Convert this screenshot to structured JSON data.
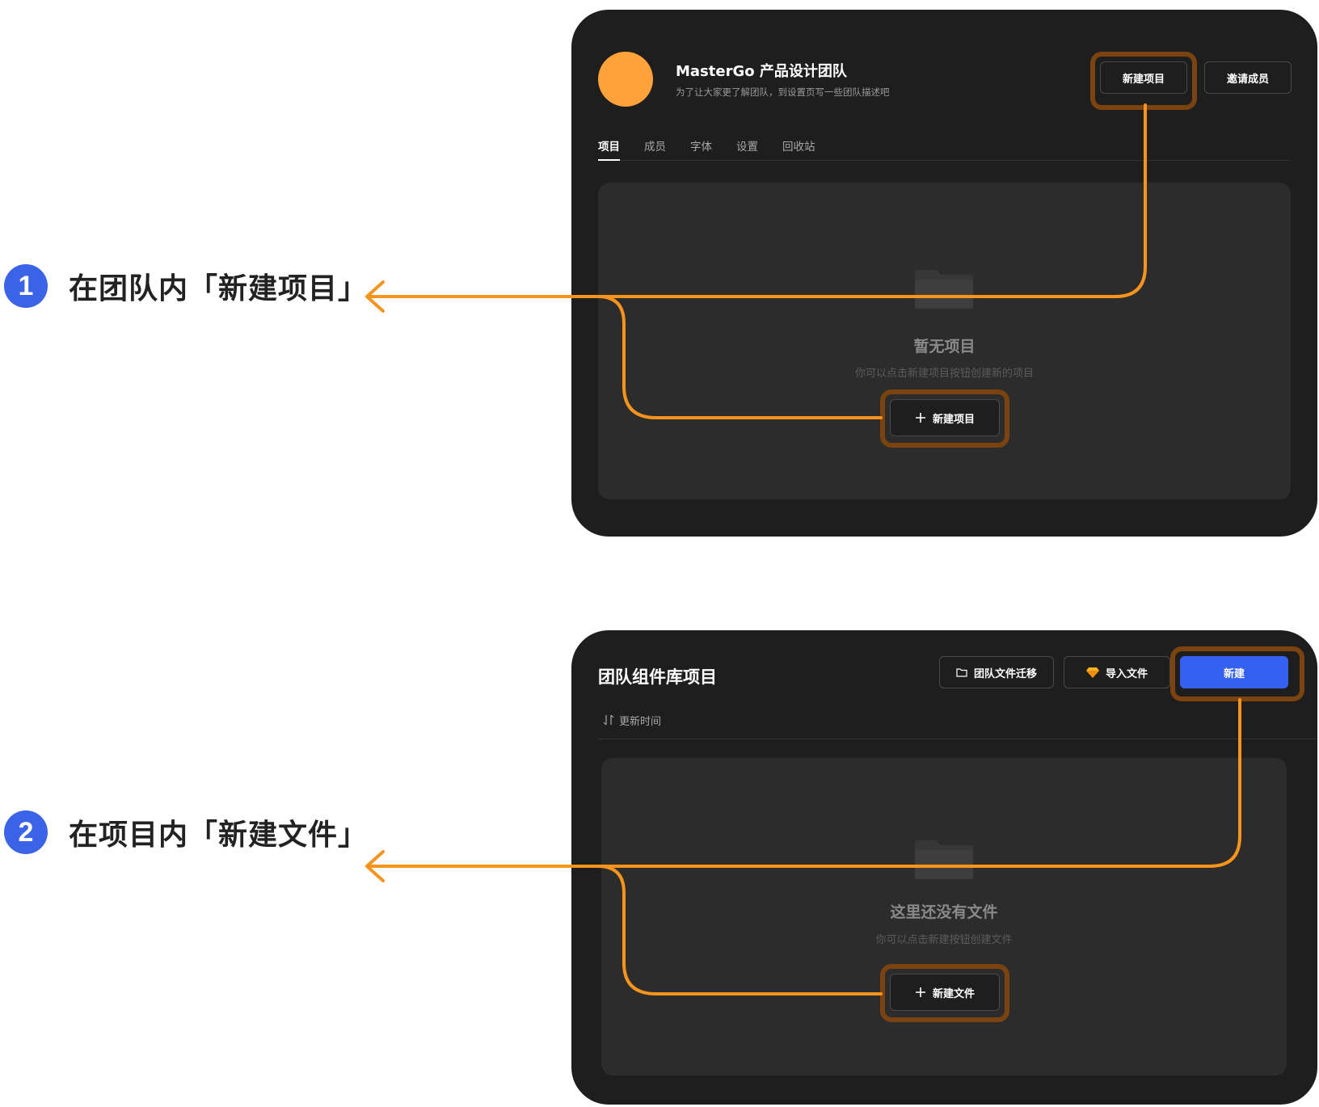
{
  "steps": [
    {
      "number": "1",
      "label": "在团队内「新建项目」"
    },
    {
      "number": "2",
      "label": "在项目内「新建文件」"
    }
  ],
  "team_page": {
    "team_name": "MasterGo 产品设计团队",
    "team_description": "为了让大家更了解团队，到设置页写一些团队描述吧",
    "new_project_button": "新建项目",
    "invite_members_button": "邀请成员",
    "tabs": [
      "项目",
      "成员",
      "字体",
      "设置",
      "回收站"
    ],
    "active_tab": "项目",
    "empty_title": "暂无项目",
    "empty_subtitle": "你可以点击新建项目按钮创建新的项目",
    "empty_new_button": "新建项目"
  },
  "project_page": {
    "title": "团队组件库项目",
    "migrate_button": "团队文件迁移",
    "import_button": "导入文件",
    "new_button": "新建",
    "sort_label": "更新时间",
    "empty_title": "这里还没有文件",
    "empty_subtitle": "你可以点击新建按钮创建文件",
    "empty_new_button": "新建文件"
  },
  "colors": {
    "accent_orange": "#f7941d",
    "highlight_ring": "#7a4310",
    "step_badge": "#3a63e8",
    "primary_button": "#3561f0",
    "panel_bg": "#1e1e1e",
    "avatar": "#ffa23a"
  }
}
